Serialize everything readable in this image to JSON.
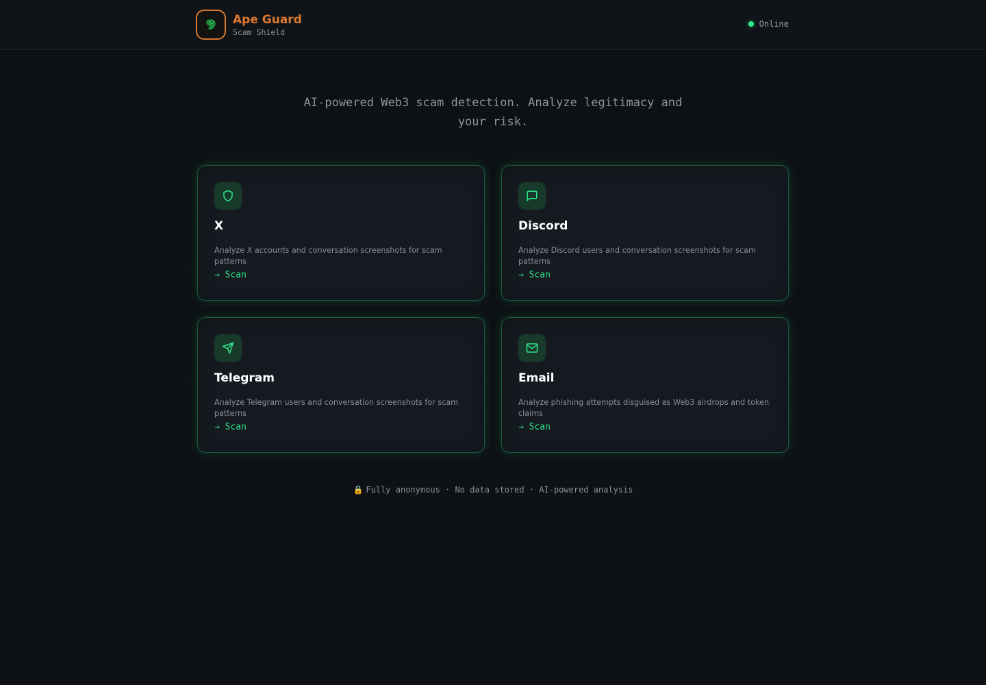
{
  "header": {
    "brand_title": "Ape Guard",
    "brand_subtitle": "Scam Shield",
    "status_label": "Online",
    "accent_color": "#d9772f",
    "status_color": "#2ee88c"
  },
  "hero": {
    "tagline": "AI-powered Web3 scam detection. Analyze legitimacy and your risk."
  },
  "cards": [
    {
      "icon": "shield-icon",
      "title": "X",
      "description": "Analyze X accounts and conversation screenshots for scam patterns",
      "cta": "→ Scan"
    },
    {
      "icon": "message-square-icon",
      "title": "Discord",
      "description": "Analyze Discord users and conversation screenshots for scam patterns",
      "cta": "→ Scan"
    },
    {
      "icon": "send-icon",
      "title": "Telegram",
      "description": "Analyze Telegram users and conversation screenshots for scam patterns",
      "cta": "→ Scan"
    },
    {
      "icon": "mail-icon",
      "title": "Email",
      "description": "Analyze phishing attempts disguised as Web3 airdrops and token claims",
      "cta": "→ Scan"
    }
  ],
  "footer": {
    "lock_icon": "🔒",
    "text": "Fully anonymous · No data stored · AI-powered analysis"
  }
}
